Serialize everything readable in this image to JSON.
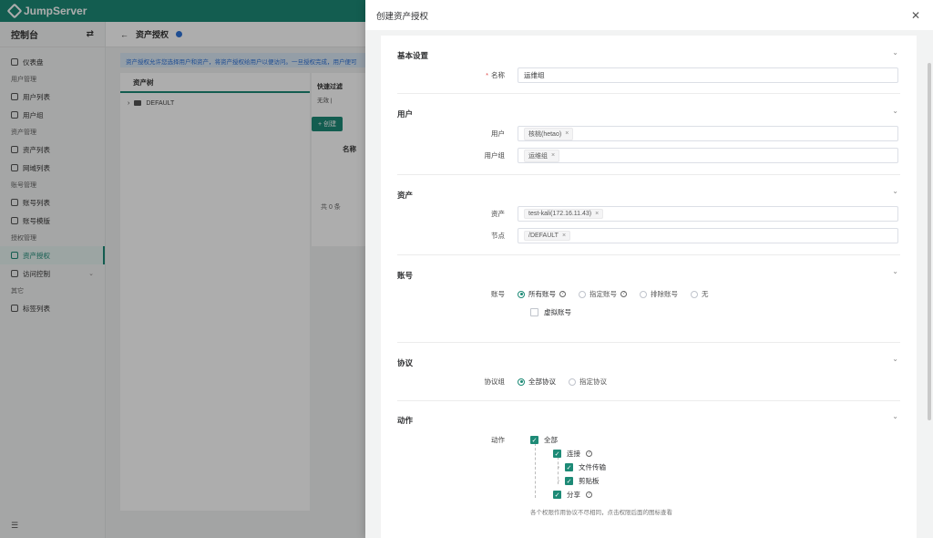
{
  "brand": {
    "name": "JumpServer"
  },
  "sidebar": {
    "title": "控制台",
    "sections": [
      {
        "id": "dash",
        "items": [
          {
            "label": "仪表盘",
            "icon": "dashboard-icon"
          }
        ]
      },
      {
        "title": "用户管理",
        "items": [
          {
            "label": "用户列表",
            "icon": "user-icon"
          },
          {
            "label": "用户组",
            "icon": "user-group-icon"
          }
        ]
      },
      {
        "title": "资产管理",
        "items": [
          {
            "label": "资产列表",
            "icon": "monitor-icon"
          },
          {
            "label": "网域列表",
            "icon": "globe-icon"
          }
        ]
      },
      {
        "title": "账号管理",
        "items": [
          {
            "label": "账号列表",
            "icon": "lock-icon"
          },
          {
            "label": "账号模版",
            "icon": "template-icon"
          }
        ]
      },
      {
        "title": "授权管理",
        "items": [
          {
            "label": "资产授权",
            "icon": "shield-icon",
            "active": true
          },
          {
            "label": "访问控制",
            "icon": "gear-icon",
            "has_children": true
          }
        ]
      },
      {
        "title": "其它",
        "items": [
          {
            "label": "标签列表",
            "icon": "tag-icon"
          }
        ]
      }
    ]
  },
  "main": {
    "title": "资产授权",
    "notice": "资产授权允许您选择用户和资产，将资产授权给用户以便访问。一旦授权完成，用户便可",
    "tree_title": "资产树",
    "tree_root": "DEFAULT",
    "quick_filter": "快速过滤",
    "quick_filter_sub": "无效 |",
    "create_btn": "+ 创建",
    "col_name": "名称",
    "total": "共 0 条"
  },
  "drawer": {
    "title": "创建资产授权",
    "sections": {
      "basic": "基本设置",
      "user": "用户",
      "asset": "资产",
      "account": "账号",
      "protocol": "协议",
      "action": "动作"
    },
    "fields": {
      "name_label": "名称",
      "name_value": "运维组",
      "users_label": "用户",
      "users_tags": [
        "核桃(hetao)"
      ],
      "user_groups_label": "用户组",
      "user_groups_tags": [
        "运维组"
      ],
      "assets_label": "资产",
      "assets_tags": [
        "test-kali(172.16.11.43)"
      ],
      "nodes_label": "节点",
      "nodes_tags": [
        "/DEFAULT"
      ],
      "accounts_label": "账号",
      "account_options": [
        "所有账号",
        "指定账号",
        "排除账号",
        "无"
      ],
      "account_selected": "所有账号",
      "virtual_account": "虚拟账号",
      "protocols_label": "协议组",
      "protocol_options": [
        "全部协议",
        "指定协议"
      ],
      "protocol_selected": "全部协议",
      "actions_label": "动作",
      "actions": {
        "all": "全部",
        "connect": "连接",
        "file_transfer": "文件传输",
        "clipboard": "剪贴板",
        "share": "分享"
      },
      "actions_hint": "各个权限作用协议不尽相同，点击权限后面的图标查看"
    }
  },
  "colors": {
    "primary": "#1d8a76",
    "required": "#e14c4c"
  }
}
